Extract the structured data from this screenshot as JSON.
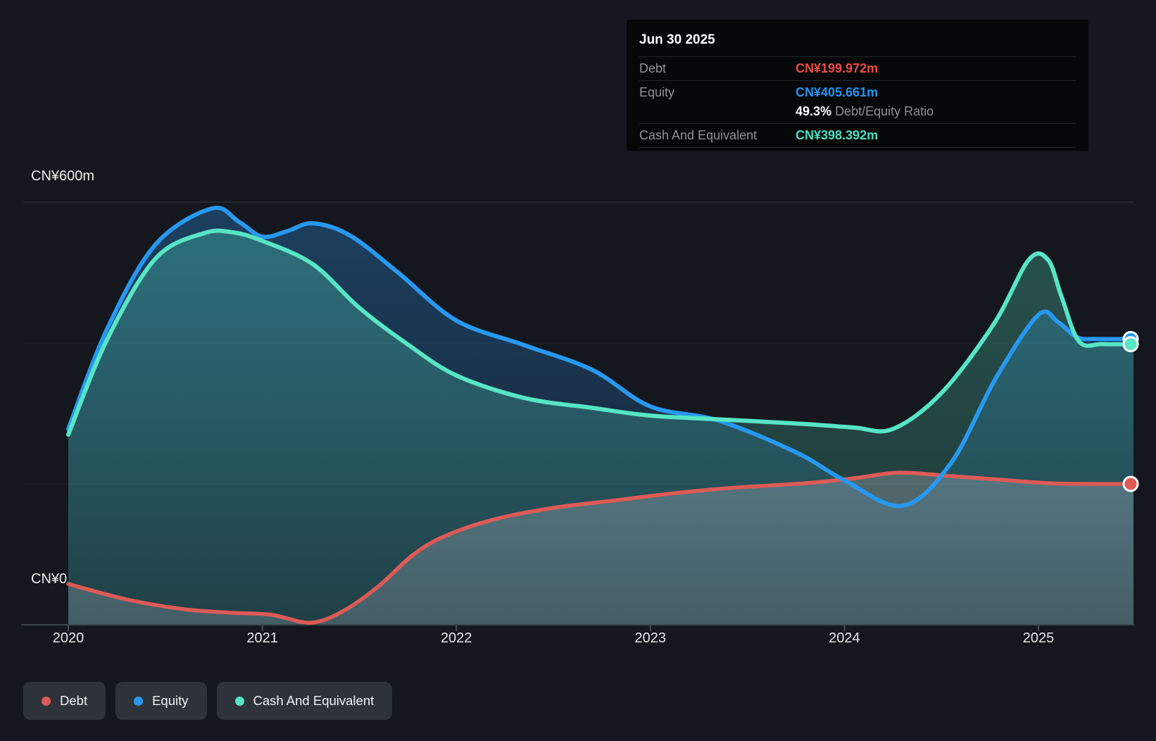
{
  "tooltip": {
    "date": "Jun 30 2025",
    "rows": {
      "debt": {
        "label": "Debt",
        "value": "CN¥199.972m",
        "value_color": "#ef4b41"
      },
      "equity": {
        "label": "Equity",
        "value": "CN¥405.661m",
        "value_color": "#2196f3"
      },
      "cash": {
        "label": "Cash And Equivalent",
        "value": "CN¥398.392m",
        "value_color": "#46e0bf"
      }
    },
    "ratio": {
      "pct": "49.3%",
      "label": "Debt/Equity Ratio"
    }
  },
  "chart_data": {
    "type": "area",
    "unit": "CN¥ millions",
    "ylim": [
      0,
      600
    ],
    "y_axis_labels": [
      "CN¥600m",
      "CN¥0"
    ],
    "grid_values": [
      600,
      400,
      200,
      0
    ],
    "x_ticks": [
      "2020",
      "2021",
      "2022",
      "2023",
      "2024",
      "2025"
    ],
    "x_end": "Jun 30 2025",
    "legend_position": "bottom-left",
    "series": [
      {
        "name": "Debt",
        "color": "#dd5a56",
        "points": [
          [
            2020.0,
            58
          ],
          [
            2020.3,
            36
          ],
          [
            2020.6,
            22
          ],
          [
            2020.85,
            17
          ],
          [
            2021.05,
            14
          ],
          [
            2021.25,
            3
          ],
          [
            2021.42,
            20
          ],
          [
            2021.6,
            55
          ],
          [
            2021.78,
            100
          ],
          [
            2021.95,
            127
          ],
          [
            2022.2,
            150
          ],
          [
            2022.5,
            166
          ],
          [
            2022.8,
            176
          ],
          [
            2023.1,
            186
          ],
          [
            2023.4,
            194
          ],
          [
            2023.8,
            201
          ],
          [
            2024.05,
            208
          ],
          [
            2024.28,
            216
          ],
          [
            2024.55,
            211
          ],
          [
            2024.8,
            206
          ],
          [
            2025.05,
            201
          ],
          [
            2025.25,
            200
          ],
          [
            2025.49,
            199.972
          ]
        ]
      },
      {
        "name": "Equity",
        "color": "#2798ef",
        "points": [
          [
            2020.0,
            278
          ],
          [
            2020.2,
            420
          ],
          [
            2020.45,
            540
          ],
          [
            2020.74,
            591
          ],
          [
            2020.88,
            572
          ],
          [
            2021.0,
            551
          ],
          [
            2021.13,
            559
          ],
          [
            2021.26,
            570
          ],
          [
            2021.45,
            553
          ],
          [
            2021.7,
            500
          ],
          [
            2022.0,
            432
          ],
          [
            2022.35,
            397
          ],
          [
            2022.7,
            362
          ],
          [
            2023.0,
            310
          ],
          [
            2023.35,
            290
          ],
          [
            2023.75,
            245
          ],
          [
            2024.0,
            205
          ],
          [
            2024.3,
            169
          ],
          [
            2024.55,
            230
          ],
          [
            2024.78,
            350
          ],
          [
            2025.0,
            440
          ],
          [
            2025.1,
            430
          ],
          [
            2025.2,
            408
          ],
          [
            2025.3,
            405.8
          ],
          [
            2025.49,
            405.661
          ]
        ]
      },
      {
        "name": "Cash And Equivalent",
        "color": "#57e5c5",
        "points": [
          [
            2020.0,
            270
          ],
          [
            2020.2,
            405
          ],
          [
            2020.45,
            520
          ],
          [
            2020.7,
            556
          ],
          [
            2020.85,
            557
          ],
          [
            2021.0,
            545
          ],
          [
            2021.26,
            512
          ],
          [
            2021.5,
            450
          ],
          [
            2021.75,
            398
          ],
          [
            2022.0,
            354
          ],
          [
            2022.35,
            322
          ],
          [
            2022.7,
            308
          ],
          [
            2023.0,
            297
          ],
          [
            2023.4,
            291
          ],
          [
            2023.8,
            285
          ],
          [
            2024.05,
            280
          ],
          [
            2024.25,
            278
          ],
          [
            2024.5,
            329
          ],
          [
            2024.77,
            427
          ],
          [
            2024.95,
            518
          ],
          [
            2025.05,
            518
          ],
          [
            2025.12,
            465
          ],
          [
            2025.21,
            402
          ],
          [
            2025.33,
            398.5
          ],
          [
            2025.49,
            398.392
          ]
        ]
      }
    ]
  }
}
